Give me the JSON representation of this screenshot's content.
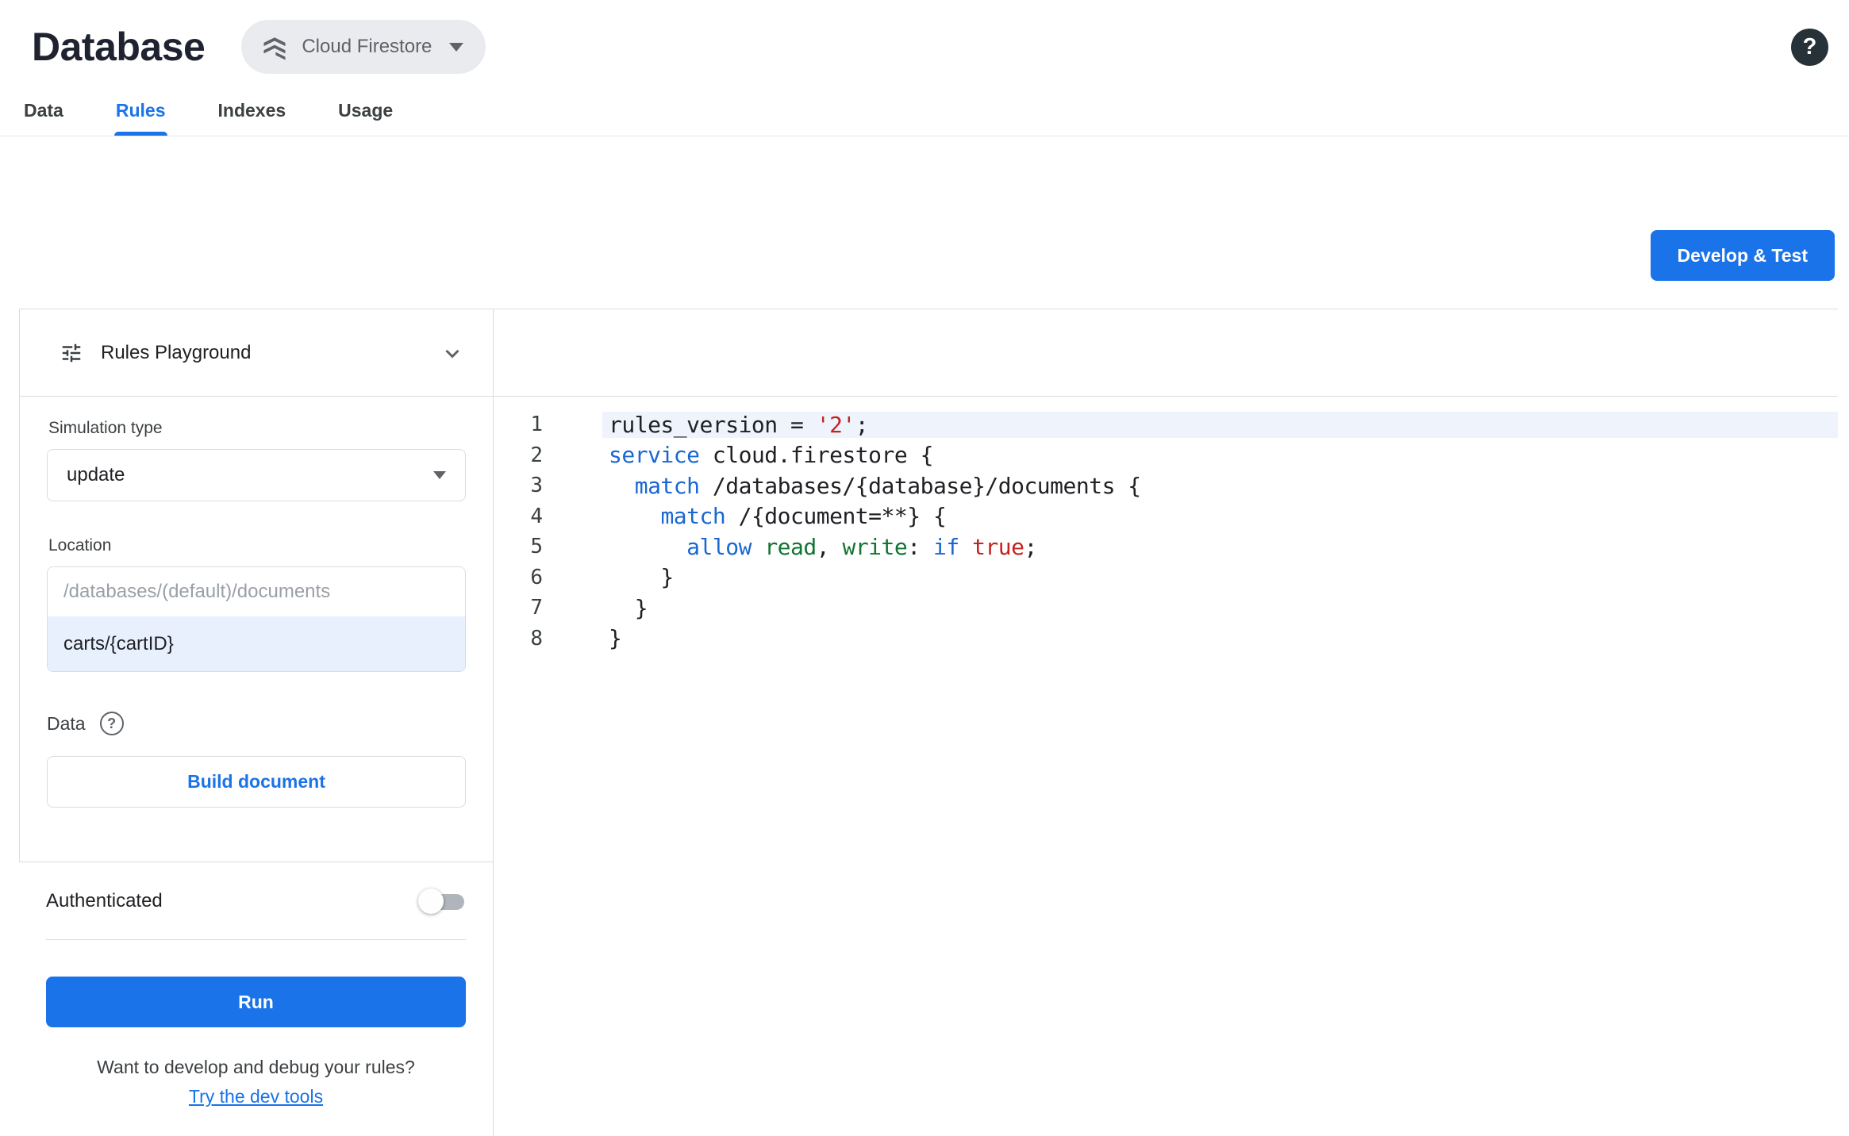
{
  "header": {
    "title": "Database",
    "product_chip": "Cloud Firestore"
  },
  "icons": {
    "help_glyph": "?",
    "product_icon": "cloud-firestore-logo",
    "playground_icon": "tune-sliders"
  },
  "tabs": [
    {
      "label": "Data",
      "active": false
    },
    {
      "label": "Rules",
      "active": true
    },
    {
      "label": "Indexes",
      "active": false
    },
    {
      "label": "Usage",
      "active": false
    }
  ],
  "toolbar": {
    "develop_test_label": "Develop & Test"
  },
  "playground": {
    "title": "Rules Playground",
    "simulation_type_label": "Simulation type",
    "simulation_type_value": "update",
    "location_label": "Location",
    "location_placeholder": "/databases/(default)/documents",
    "location_value": "carts/{cartID}",
    "data_label": "Data",
    "build_document_label": "Build document",
    "authenticated_label": "Authenticated",
    "authenticated_on": false,
    "run_label": "Run",
    "dev_tools_text": "Want to develop and debug your rules?",
    "dev_tools_link": "Try the dev tools"
  },
  "editor": {
    "active_line": 1,
    "colors": {
      "keyword": "#1967d2",
      "string": "#c5221f",
      "prop": "#137333",
      "plain": "#202124"
    },
    "lines": [
      {
        "num": 1,
        "segments": [
          {
            "t": "rules_version = ",
            "c": "plain"
          },
          {
            "t": "'2'",
            "c": "string"
          },
          {
            "t": ";",
            "c": "plain"
          }
        ]
      },
      {
        "num": 2,
        "segments": [
          {
            "t": "service",
            "c": "keyword"
          },
          {
            "t": " cloud.firestore {",
            "c": "plain"
          }
        ]
      },
      {
        "num": 3,
        "segments": [
          {
            "t": "  ",
            "c": "plain"
          },
          {
            "t": "match",
            "c": "keyword"
          },
          {
            "t": " /databases/{database}/documents {",
            "c": "plain"
          }
        ]
      },
      {
        "num": 4,
        "segments": [
          {
            "t": "    ",
            "c": "plain"
          },
          {
            "t": "match",
            "c": "keyword"
          },
          {
            "t": " /{document=**} {",
            "c": "plain"
          }
        ]
      },
      {
        "num": 5,
        "segments": [
          {
            "t": "      ",
            "c": "plain"
          },
          {
            "t": "allow",
            "c": "keyword"
          },
          {
            "t": " ",
            "c": "plain"
          },
          {
            "t": "read",
            "c": "prop"
          },
          {
            "t": ", ",
            "c": "plain"
          },
          {
            "t": "write",
            "c": "prop"
          },
          {
            "t": ": ",
            "c": "plain"
          },
          {
            "t": "if",
            "c": "keyword"
          },
          {
            "t": " ",
            "c": "plain"
          },
          {
            "t": "true",
            "c": "string"
          },
          {
            "t": ";",
            "c": "plain"
          }
        ]
      },
      {
        "num": 6,
        "segments": [
          {
            "t": "    }",
            "c": "plain"
          }
        ]
      },
      {
        "num": 7,
        "segments": [
          {
            "t": "  }",
            "c": "plain"
          }
        ]
      },
      {
        "num": 8,
        "segments": [
          {
            "t": "}",
            "c": "plain"
          }
        ]
      }
    ]
  }
}
